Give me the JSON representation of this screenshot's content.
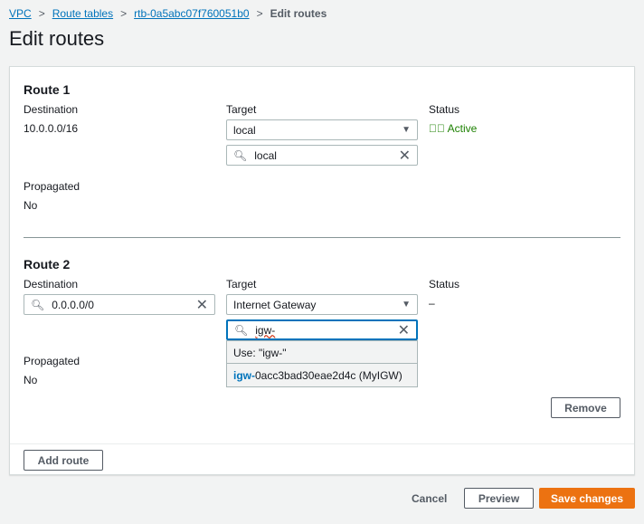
{
  "breadcrumb": [
    "VPC",
    "Route tables",
    "rtb-0a5abc07f760051b0",
    "Edit routes"
  ],
  "title": "Edit routes",
  "labels": {
    "destination": "Destination",
    "target": "Target",
    "status": "Status",
    "propagated": "Propagated"
  },
  "routes": [
    {
      "title": "Route 1",
      "destination": "10.0.0.0/16",
      "target": "local",
      "target_search": "local",
      "status": "Active",
      "propagated": "No"
    },
    {
      "title": "Route 2",
      "destination": "0.0.0.0/0",
      "target": "Internet Gateway",
      "target_search": "igw-",
      "status": "–",
      "propagated": "No",
      "dropdown": {
        "use_option": "Use: \"igw-\"",
        "match_prefix": "igw-",
        "match_rest": "0acc3bad30eae2d4c (MyIGW)"
      }
    }
  ],
  "buttons": {
    "remove": "Remove",
    "add_route": "Add route",
    "cancel": "Cancel",
    "preview": "Preview",
    "save": "Save changes"
  },
  "colors": {
    "accent": "#ec7211",
    "link": "#0073bb",
    "success": "#1d8102"
  }
}
